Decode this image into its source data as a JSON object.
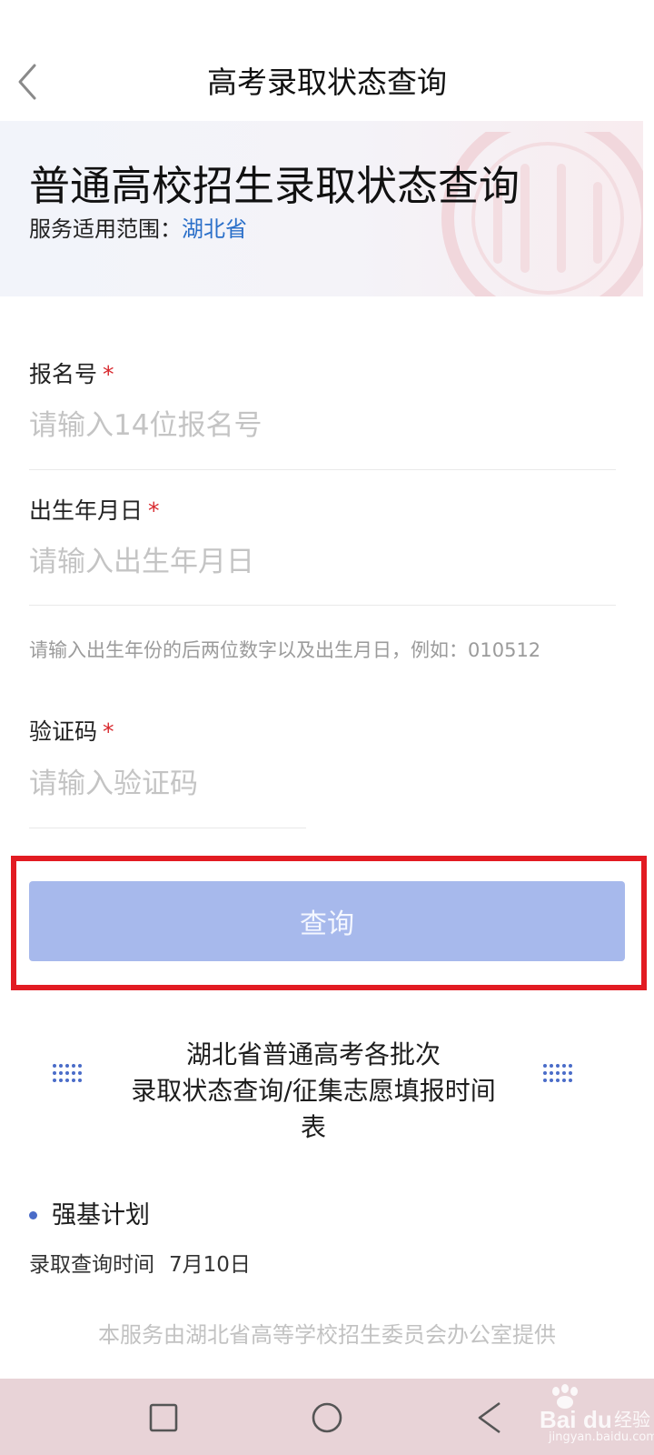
{
  "header": {
    "title": "高考录取状态查询"
  },
  "banner": {
    "title": "普通高校招生录取状态查询",
    "scope_label": "服务适用范围：",
    "scope_value": "湖北省"
  },
  "form": {
    "required_mark": "*",
    "registration_number": {
      "label": "报名号",
      "placeholder": "请输入14位报名号"
    },
    "birth_date": {
      "label": "出生年月日",
      "placeholder": "请输入出生年月日",
      "hint": "请输入出生年份的后两位数字以及出生月日，例如：010512"
    },
    "captcha": {
      "label": "验证码",
      "placeholder": "请输入验证码"
    },
    "submit_label": "查询"
  },
  "schedule": {
    "title_lines": [
      "湖北省普通高考各批次",
      "录取状态查询/征集志愿填报时间",
      "表"
    ],
    "items": [
      {
        "name": "强基计划",
        "time_label": "录取查询时间",
        "time_value": "7月10日"
      }
    ]
  },
  "footer": {
    "text": "本服务由湖北省高等学校招生委员会办公室提供"
  },
  "watermark": {
    "logo_text": "Bai du 经验",
    "url_text": "jingyan.baidu.com"
  },
  "system_nav": {
    "buttons": [
      "recent-apps",
      "home",
      "back"
    ]
  },
  "colors": {
    "accent_link": "#2a6fc9",
    "required": "#d8282d",
    "button_bg": "#a7b9ec",
    "highlight_border": "#e21b22",
    "system_bar": "#e8d3d7"
  }
}
